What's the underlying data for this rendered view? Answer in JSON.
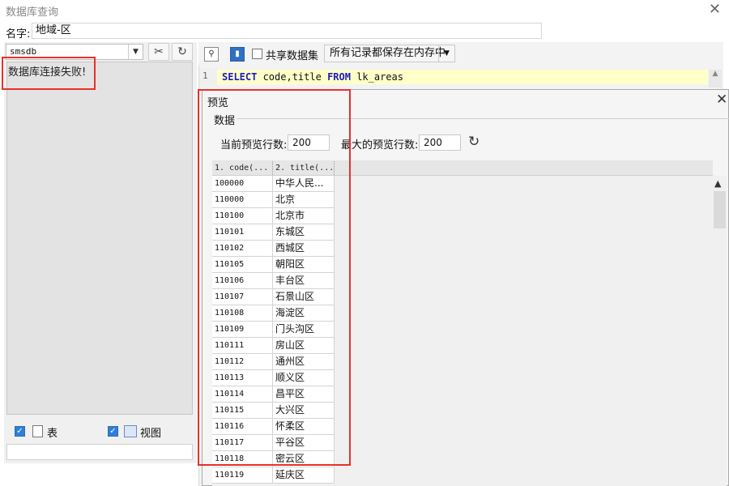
{
  "window": {
    "title": "数据库查询",
    "close_glyph": "✕"
  },
  "name_field": {
    "label": "名字:",
    "value": "地域-区"
  },
  "left": {
    "datasource": "smsdb",
    "error_message": "数据库连接失败!",
    "checkbox_tables": "表",
    "checkbox_views": "视图",
    "icons": [
      "settings-tool-icon",
      "refresh-icon"
    ]
  },
  "editor": {
    "share_label": "共享数据集",
    "memory_option": "所有记录都保存在内存中",
    "line_number": "1",
    "sql": {
      "kw1": "SELECT",
      "mid": " code,title ",
      "kw2": "FROM",
      "tail": " lk_areas"
    }
  },
  "preview": {
    "title": "预览",
    "close_glyph": "✕",
    "group_label": "数据",
    "current_rows_label": "当前预览行数:",
    "current_rows_value": "200",
    "max_rows_label": "最大的预览行数:",
    "max_rows_value": "200",
    "columns": [
      "1. code(...",
      "2. title(..."
    ],
    "rows": [
      [
        "100000",
        "中华人民..."
      ],
      [
        "110000",
        "北京"
      ],
      [
        "110100",
        "北京市"
      ],
      [
        "110101",
        "东城区"
      ],
      [
        "110102",
        "西城区"
      ],
      [
        "110105",
        "朝阳区"
      ],
      [
        "110106",
        "丰台区"
      ],
      [
        "110107",
        "石景山区"
      ],
      [
        "110108",
        "海淀区"
      ],
      [
        "110109",
        "门头沟区"
      ],
      [
        "110111",
        "房山区"
      ],
      [
        "110112",
        "通州区"
      ],
      [
        "110113",
        "顺义区"
      ],
      [
        "110114",
        "昌平区"
      ],
      [
        "110115",
        "大兴区"
      ],
      [
        "110116",
        "怀柔区"
      ],
      [
        "110117",
        "平谷区"
      ],
      [
        "110118",
        "密云区"
      ],
      [
        "110119",
        "延庆区"
      ]
    ]
  },
  "colors": {
    "highlight_box": "#e8302a",
    "sql_line_bg": "#ffffc8",
    "keyword": "#1a1ac8"
  }
}
